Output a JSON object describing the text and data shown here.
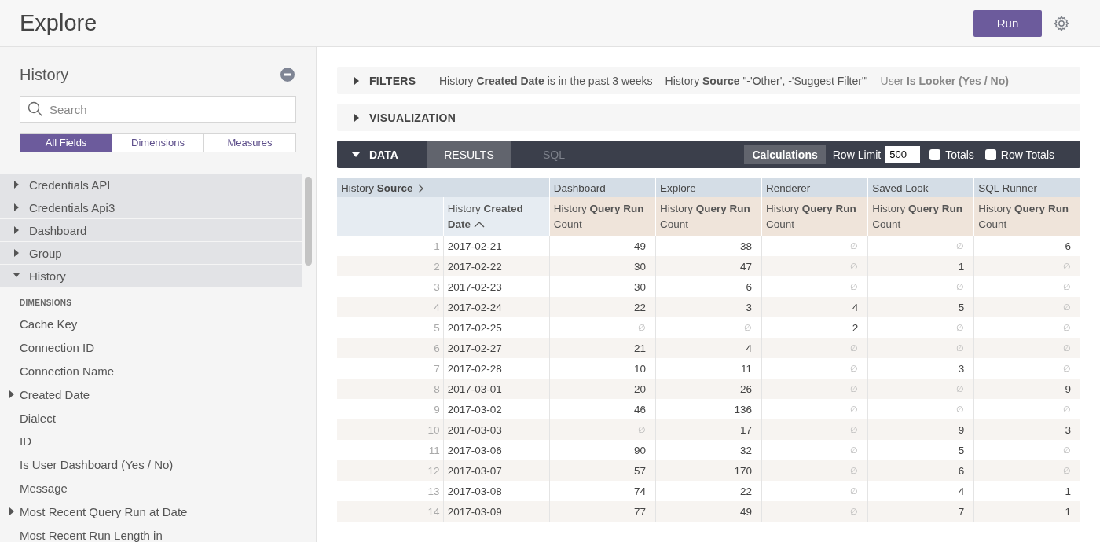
{
  "header": {
    "title": "Explore",
    "run_button": "Run"
  },
  "sidebar": {
    "title": "History",
    "search": {
      "placeholder": "Search"
    },
    "tabs": [
      {
        "label": "All Fields",
        "selected": true
      },
      {
        "label": "Dimensions",
        "selected": false
      },
      {
        "label": "Measures",
        "selected": false
      }
    ],
    "views": [
      {
        "label": "Credentials API",
        "expanded": false
      },
      {
        "label": "Credentials Api3",
        "expanded": false
      },
      {
        "label": "Dashboard",
        "expanded": false
      },
      {
        "label": "Group",
        "expanded": false
      },
      {
        "label": "History",
        "expanded": true
      }
    ],
    "section_heading": "DIMENSIONS",
    "fields": [
      {
        "label": "Cache Key",
        "expandable": false
      },
      {
        "label": "Connection ID",
        "expandable": false
      },
      {
        "label": "Connection Name",
        "expandable": false
      },
      {
        "label": "Created Date",
        "expandable": true
      },
      {
        "label": "Dialect",
        "expandable": false
      },
      {
        "label": "ID",
        "expandable": false
      },
      {
        "label": "Is User Dashboard (Yes / No)",
        "expandable": false
      },
      {
        "label": "Message",
        "expandable": false
      },
      {
        "label": "Most Recent Query Run at Date",
        "expandable": true
      },
      {
        "label": "Most Recent Run Length in",
        "expandable": false
      }
    ]
  },
  "filters": {
    "label": "FILTERS",
    "expanded": false,
    "items": [
      "History **Created Date** is in the past 3 weeks",
      "History **Source** \"-'Other', -'Suggest Filter'\"",
      "User **Is Looker (Yes / No)**"
    ]
  },
  "visualization": {
    "label": "VISUALIZATION",
    "expanded": false
  },
  "data_bar": {
    "label": "DATA",
    "expanded": true,
    "tabs": [
      {
        "label": "RESULTS",
        "selected": true
      },
      {
        "label": "SQL",
        "selected": false
      }
    ],
    "calculations_button": "Calculations",
    "row_limit_label": "Row Limit",
    "row_limit": "500",
    "totals": {
      "label": "Totals",
      "checked": false
    },
    "row_totals": {
      "label": "Row Totals",
      "checked": false
    }
  },
  "table": {
    "pivot_label": "History **Source**",
    "pivot_columns": [
      "Dashboard",
      "Explore",
      "Renderer",
      "Saved Look",
      "SQL Runner"
    ],
    "dimension_header": "History **Created Date**",
    "measure_headers": [
      "History **Query Run** Count",
      "History **Query Run** Count",
      "History **Query Run** Count",
      "History **Query Run** Count",
      "History **Query Run** Count"
    ],
    "rows": [
      {
        "index": "1",
        "date": "2017-02-21",
        "values": [
          "49",
          "38",
          "∅",
          "∅",
          "6"
        ]
      },
      {
        "index": "2",
        "date": "2017-02-22",
        "values": [
          "30",
          "47",
          "∅",
          "1",
          "∅"
        ]
      },
      {
        "index": "3",
        "date": "2017-02-23",
        "values": [
          "30",
          "6",
          "∅",
          "∅",
          "∅"
        ]
      },
      {
        "index": "4",
        "date": "2017-02-24",
        "values": [
          "22",
          "3",
          "4",
          "5",
          "∅"
        ]
      },
      {
        "index": "5",
        "date": "2017-02-25",
        "values": [
          "∅",
          "∅",
          "2",
          "∅",
          "∅"
        ]
      },
      {
        "index": "6",
        "date": "2017-02-27",
        "values": [
          "21",
          "4",
          "∅",
          "∅",
          "∅"
        ]
      },
      {
        "index": "7",
        "date": "2017-02-28",
        "values": [
          "10",
          "11",
          "∅",
          "3",
          "∅"
        ]
      },
      {
        "index": "8",
        "date": "2017-03-01",
        "values": [
          "20",
          "26",
          "∅",
          "∅",
          "9"
        ]
      },
      {
        "index": "9",
        "date": "2017-03-02",
        "values": [
          "46",
          "136",
          "∅",
          "∅",
          "∅"
        ]
      },
      {
        "index": "10",
        "date": "2017-03-03",
        "values": [
          "∅",
          "17",
          "∅",
          "9",
          "3"
        ]
      },
      {
        "index": "11",
        "date": "2017-03-06",
        "values": [
          "90",
          "32",
          "∅",
          "5",
          "∅"
        ]
      },
      {
        "index": "12",
        "date": "2017-03-07",
        "values": [
          "57",
          "170",
          "∅",
          "6",
          "∅"
        ]
      },
      {
        "index": "13",
        "date": "2017-03-08",
        "values": [
          "74",
          "22",
          "∅",
          "4",
          "1"
        ]
      },
      {
        "index": "14",
        "date": "2017-03-09",
        "values": [
          "77",
          "49",
          "∅",
          "7",
          "1"
        ]
      }
    ]
  }
}
